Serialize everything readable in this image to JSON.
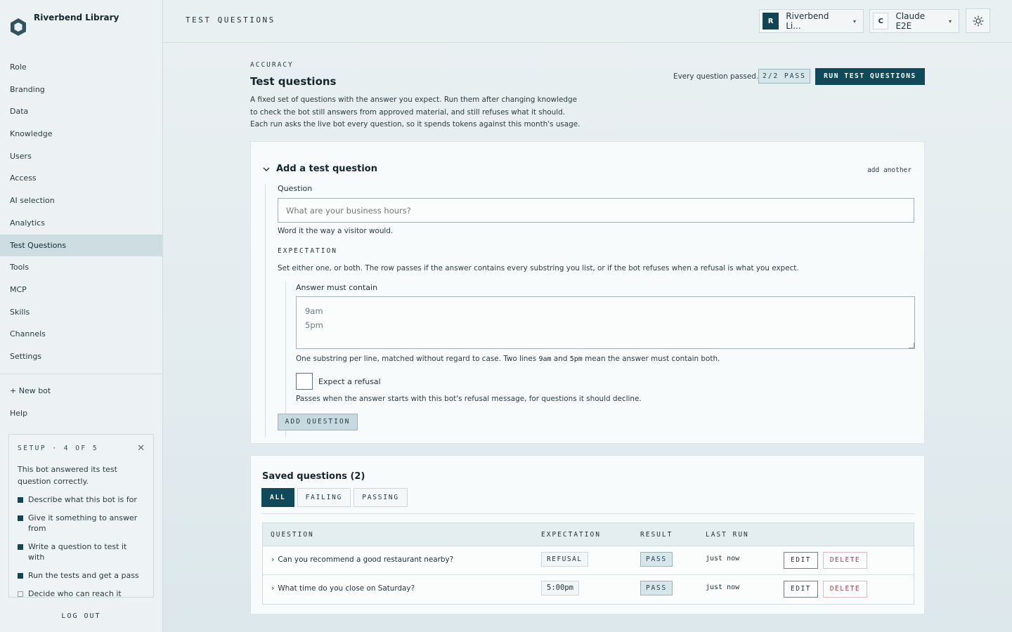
{
  "brand": {
    "name": "Riverbend Library"
  },
  "sidebar": {
    "items": [
      {
        "label": "Role"
      },
      {
        "label": "Branding"
      },
      {
        "label": "Data"
      },
      {
        "label": "Knowledge"
      },
      {
        "label": "Users"
      },
      {
        "label": "Access"
      },
      {
        "label": "AI selection"
      },
      {
        "label": "Analytics"
      },
      {
        "label": "Test Questions",
        "active": true
      },
      {
        "label": "Tools"
      },
      {
        "label": "MCP"
      },
      {
        "label": "Skills"
      },
      {
        "label": "Channels"
      },
      {
        "label": "Settings"
      }
    ],
    "extra": [
      {
        "label": "+ New bot"
      },
      {
        "label": "Help"
      }
    ],
    "setup": {
      "heading": "SETUP · 4 OF 5",
      "message": "This bot answered its test question correctly.",
      "steps": [
        {
          "label": "Describe what this bot is for",
          "done": true
        },
        {
          "label": "Give it something to answer from",
          "done": true
        },
        {
          "label": "Write a question to test it with",
          "done": true
        },
        {
          "label": "Run the tests and get a pass",
          "done": true
        },
        {
          "label": "Decide who can reach it",
          "done": false
        }
      ]
    },
    "logout": "LOG OUT"
  },
  "header": {
    "page_label": "TEST QUESTIONS",
    "org_picker": {
      "initial": "R",
      "name": "Riverbend Li...",
      "badge_color": "#0f4555"
    },
    "model_picker": {
      "initial": "C",
      "name": "Claude E2E"
    }
  },
  "main": {
    "eyebrow": "ACCURACY",
    "title": "Test questions",
    "description": "A fixed set of questions with the answer you expect. Run them after changing knowledge to check the bot still answers from approved material, and still refuses what it should. Each run asks the live bot every question, so it spends tokens against this month's usage.",
    "status_text": "Every question passed.",
    "pass_summary": "2/2 PASS",
    "run_button": "RUN TEST QUESTIONS"
  },
  "add_form": {
    "heading": "Add a test question",
    "add_another": "add another",
    "question_label": "Question",
    "question_placeholder": "What are your business hours?",
    "question_hint": "Word it the way a visitor would.",
    "expectation_heading": "EXPECTATION",
    "expectation_hint": "Set either one, or both. The row passes if the answer contains every substring you list, or if the bot refuses when a refusal is what you expect.",
    "contain_label": "Answer must contain",
    "contain_value": "9am\n5pm",
    "contain_hint_prefix": "One substring per line, matched without regard to case. Two lines ",
    "contain_hint_code1": "9am",
    "contain_hint_mid": " and ",
    "contain_hint_code2": "5pm",
    "contain_hint_suffix": " mean the answer must contain both.",
    "refusal_label": "Expect a refusal",
    "refusal_hint": "Passes when the answer starts with this bot's refusal message, for questions it should decline.",
    "submit": "ADD QUESTION"
  },
  "saved": {
    "title": "Saved questions (2)",
    "filters": [
      {
        "label": "ALL",
        "active": true
      },
      {
        "label": "FAILING",
        "active": false
      },
      {
        "label": "PASSING",
        "active": false
      }
    ],
    "columns": {
      "question": "QUESTION",
      "expectation": "EXPECTATION",
      "result": "RESULT",
      "last_run": "LAST RUN"
    },
    "rows": [
      {
        "question": "Can you recommend a good restaurant nearby?",
        "expectation": "REFUSAL",
        "result": "PASS",
        "last_run": "just now",
        "edit": "EDIT",
        "delete": "DELETE"
      },
      {
        "question": "What time do you close on Saturday?",
        "expectation": "5:00pm",
        "result": "PASS",
        "last_run": "just now",
        "edit": "EDIT",
        "delete": "DELETE"
      }
    ]
  }
}
